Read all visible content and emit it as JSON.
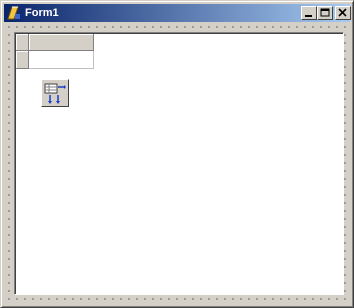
{
  "window": {
    "title": "Form1",
    "icon": "delphi-app-icon"
  },
  "caption_buttons": [
    {
      "name": "minimize-button",
      "icon": "minimize-icon"
    },
    {
      "name": "maximize-button",
      "icon": "maximize-icon"
    },
    {
      "name": "close-button",
      "icon": "close-icon"
    }
  ],
  "form": {
    "components": [
      {
        "type": "string-grid",
        "icon": "grid-icon"
      },
      {
        "type": "non-visual-component",
        "icon": "table-arrows-icon"
      }
    ]
  },
  "colors": {
    "titlebar_start": "#0a246a",
    "titlebar_end": "#a6caf0",
    "face": "#d4d0c8",
    "panel": "#ffffff"
  }
}
